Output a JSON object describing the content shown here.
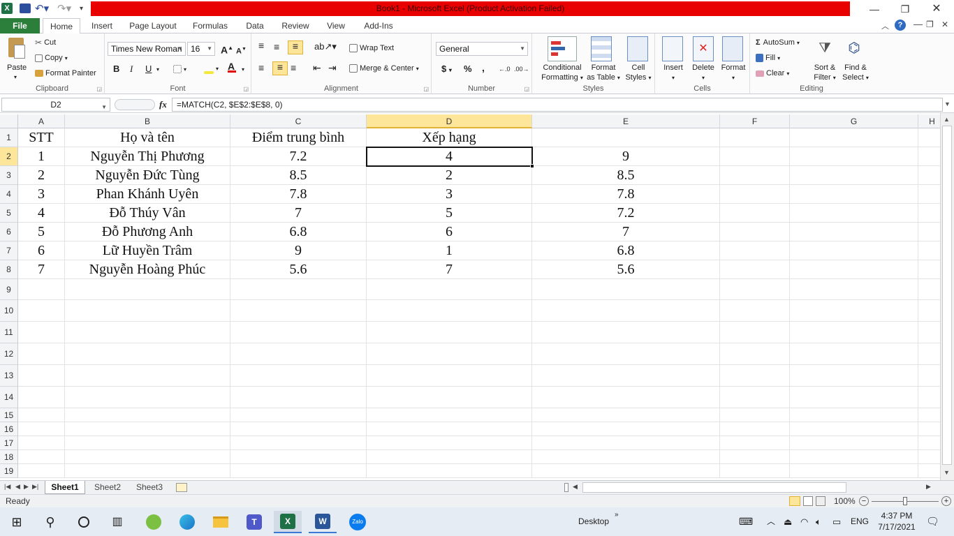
{
  "window": {
    "title": "Book1 - Microsoft Excel (Product Activation Failed)"
  },
  "ribbon_tabs": [
    "File",
    "Home",
    "Insert",
    "Page Layout",
    "Formulas",
    "Data",
    "Review",
    "View",
    "Add-Ins"
  ],
  "clipboard": {
    "paste": "Paste",
    "cut": "Cut",
    "copy": "Copy",
    "format_painter": "Format Painter",
    "label": "Clipboard"
  },
  "font": {
    "name": "Times New Roman",
    "size": "16",
    "bold": "B",
    "italic": "I",
    "underline": "U",
    "label": "Font"
  },
  "alignment": {
    "wrap": "Wrap Text",
    "merge": "Merge & Center",
    "label": "Alignment"
  },
  "number": {
    "format": "General",
    "currency": "$",
    "percent": "%",
    "comma": ",",
    "label": "Number"
  },
  "styles": {
    "conditional": "Conditional",
    "conditional2": "Formatting",
    "format_table": "Format",
    "format_table2": "as Table",
    "cell_styles": "Cell",
    "cell_styles2": "Styles",
    "label": "Styles"
  },
  "cells_group": {
    "insert": "Insert",
    "delete": "Delete",
    "format": "Format",
    "label": "Cells"
  },
  "editing": {
    "autosum": "AutoSum",
    "fill": "Fill",
    "clear": "Clear",
    "sort": "Sort &",
    "sort2": "Filter",
    "find": "Find &",
    "find2": "Select",
    "label": "Editing"
  },
  "formula_bar": {
    "name_box": "D2",
    "fx": "fx",
    "formula": "=MATCH(C2, $E$2:$E$8, 0)"
  },
  "columns": [
    "A",
    "B",
    "C",
    "D",
    "E",
    "F",
    "G",
    "H"
  ],
  "rows": [
    "1",
    "2",
    "3",
    "4",
    "5",
    "6",
    "7",
    "8",
    "9",
    "10",
    "11",
    "12",
    "13",
    "14",
    "15",
    "16",
    "17",
    "18",
    "19"
  ],
  "table": {
    "header": [
      "STT",
      "Họ và tên",
      "Điểm trung bình",
      "Xếp hạng",
      ""
    ],
    "rows": [
      [
        "1",
        "Nguyễn Thị Phương",
        "7.2",
        "4",
        "9"
      ],
      [
        "2",
        "Nguyễn Đức Tùng",
        "8.5",
        "2",
        "8.5"
      ],
      [
        "3",
        "Phan Khánh Uyên",
        "7.8",
        "3",
        "7.8"
      ],
      [
        "4",
        "Đỗ Thúy Vân",
        "7",
        "5",
        "7.2"
      ],
      [
        "5",
        "Đỗ Phương Anh",
        "6.8",
        "6",
        "7"
      ],
      [
        "6",
        "Lữ Huyền Trâm",
        "9",
        "1",
        "6.8"
      ],
      [
        "7",
        "Nguyễn Hoàng Phúc",
        "5.6",
        "7",
        "5.6"
      ]
    ]
  },
  "selected_cell": "D2",
  "sheets": [
    "Sheet1",
    "Sheet2",
    "Sheet3"
  ],
  "active_sheet": "Sheet1",
  "status": {
    "mode": "Ready",
    "zoom": "100%"
  },
  "taskbar": {
    "desktop": "Desktop",
    "lang": "ENG",
    "time": "4:37 PM",
    "date": "7/17/2021"
  },
  "colors": {
    "title_red": "#e90000",
    "file_tab": "#2b7f3a",
    "selected_header": "#fde59a"
  }
}
